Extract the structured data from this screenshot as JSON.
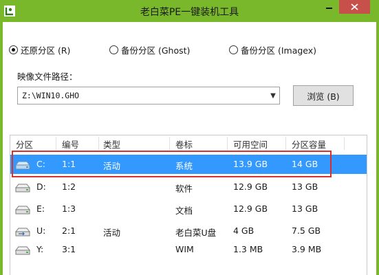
{
  "window": {
    "title": "老白菜PE一键装机工具"
  },
  "mode_options": [
    {
      "label": "还原分区 (R)",
      "checked": true
    },
    {
      "label": "备份分区 (Ghost)",
      "checked": false
    },
    {
      "label": "备份分区 (Imagex)",
      "checked": false
    }
  ],
  "image_path": {
    "label": "映像文件路径：",
    "value": "Z:\\WIN10.GHO",
    "browse_label": "浏览 (B)"
  },
  "partition_table": {
    "columns": [
      "分区",
      "编号",
      "类型",
      "卷标",
      "可用空间",
      "分区容量"
    ],
    "rows": [
      {
        "drive": "C:",
        "number": "1:1",
        "type": "活动",
        "label": "系统",
        "free": "13.9 GB",
        "capacity": "14 GB",
        "selected": true,
        "icon": "drive-icon"
      },
      {
        "drive": "D:",
        "number": "1:2",
        "type": "",
        "label": "软件",
        "free": "12.9 GB",
        "capacity": "13 GB",
        "selected": false,
        "icon": "drive-icon"
      },
      {
        "drive": "E:",
        "number": "1:3",
        "type": "",
        "label": "文档",
        "free": "12.9 GB",
        "capacity": "13 GB",
        "selected": false,
        "icon": "drive-icon"
      },
      {
        "drive": "U:",
        "number": "2:1",
        "type": "活动",
        "label": "老白菜U盘",
        "free": "4 GB",
        "capacity": "7.5 GB",
        "selected": false,
        "icon": "usb-drive-icon"
      },
      {
        "drive": "Y:",
        "number": "3:1",
        "type": "",
        "label": "WIM",
        "free": "1.3 MB",
        "capacity": "3.9 MB",
        "selected": false,
        "icon": "drive-icon"
      }
    ]
  },
  "colors": {
    "title_bar": "#7ab82b",
    "selection": "#3399ff",
    "highlight": "#d9302e",
    "close_button": "#c7504a"
  }
}
